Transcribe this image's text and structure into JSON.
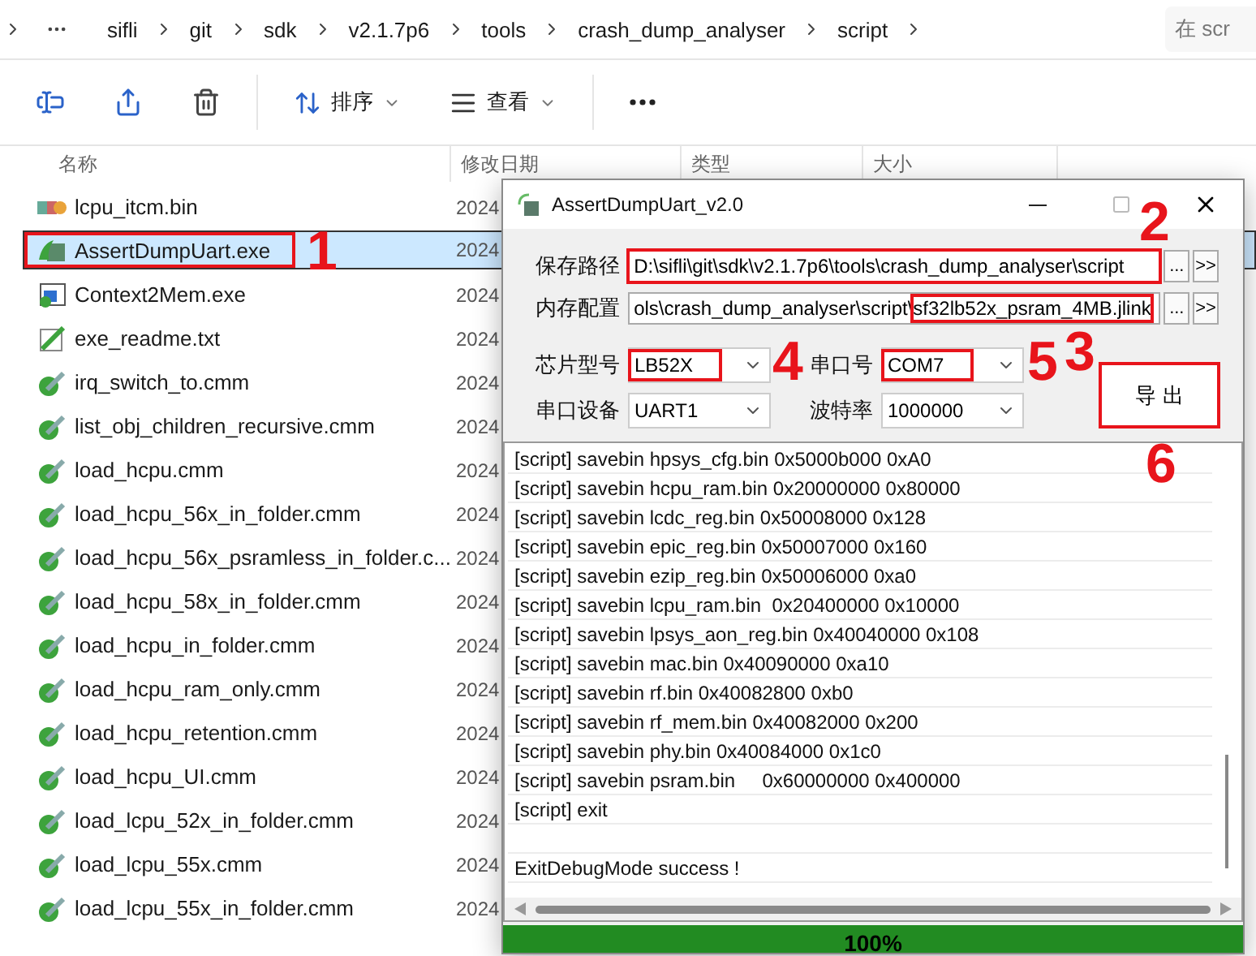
{
  "address_bar": {
    "crumbs": [
      "sifli",
      "git",
      "sdk",
      "v2.1.7p6",
      "tools",
      "crash_dump_analyser",
      "script"
    ],
    "search_placeholder": "在 scr"
  },
  "toolbar": {
    "sort_label": "排序",
    "view_label": "查看"
  },
  "file_list": {
    "columns": [
      "名称",
      "修改日期",
      "类型",
      "大小"
    ],
    "rows": [
      {
        "name": "lcpu_itcm.bin",
        "date": "2024",
        "kind": "bin",
        "selected": false
      },
      {
        "name": "AssertDumpUart.exe",
        "date": "2024",
        "kind": "app",
        "selected": true,
        "marker": "1"
      },
      {
        "name": "Context2Mem.exe",
        "date": "2024",
        "kind": "exe",
        "selected": false
      },
      {
        "name": "exe_readme.txt",
        "date": "2024",
        "kind": "txt",
        "selected": false
      },
      {
        "name": "irq_switch_to.cmm",
        "date": "2024",
        "kind": "cmm",
        "selected": false
      },
      {
        "name": "list_obj_children_recursive.cmm",
        "date": "2024",
        "kind": "cmm",
        "selected": false
      },
      {
        "name": "load_hcpu.cmm",
        "date": "2024",
        "kind": "cmm",
        "selected": false
      },
      {
        "name": "load_hcpu_56x_in_folder.cmm",
        "date": "2024",
        "kind": "cmm",
        "selected": false
      },
      {
        "name": "load_hcpu_56x_psramless_in_folder.c...",
        "date": "2024",
        "kind": "cmm",
        "selected": false
      },
      {
        "name": "load_hcpu_58x_in_folder.cmm",
        "date": "2024",
        "kind": "cmm",
        "selected": false
      },
      {
        "name": "load_hcpu_in_folder.cmm",
        "date": "2024",
        "kind": "cmm",
        "selected": false
      },
      {
        "name": "load_hcpu_ram_only.cmm",
        "date": "2024",
        "kind": "cmm",
        "selected": false
      },
      {
        "name": "load_hcpu_retention.cmm",
        "date": "2024",
        "kind": "cmm",
        "selected": false
      },
      {
        "name": "load_hcpu_UI.cmm",
        "date": "2024",
        "kind": "cmm",
        "selected": false
      },
      {
        "name": "load_lcpu_52x_in_folder.cmm",
        "date": "2024",
        "kind": "cmm",
        "selected": false
      },
      {
        "name": "load_lcpu_55x.cmm",
        "date": "2024",
        "kind": "cmm",
        "selected": false
      },
      {
        "name": "load_lcpu_55x_in_folder.cmm",
        "date": "2024",
        "kind": "cmm",
        "selected": false
      }
    ]
  },
  "dialog": {
    "title": "AssertDumpUart_v2.0",
    "save_path": {
      "label": "保存路径",
      "value": "D:\\sifli\\git\\sdk\\v2.1.7p6\\tools\\crash_dump_analyser\\script",
      "marker": "2",
      "buttons": [
        "...",
        ">>"
      ]
    },
    "memory_config": {
      "label": "内存配置",
      "value_start": "ols\\crash_dump_analyser\\script\\",
      "value_end": "sf32lb52x_psram_4MB.jlink",
      "marker": "3",
      "buttons": [
        "...",
        ">>"
      ]
    },
    "chip": {
      "label": "芯片型号",
      "value": "LB52X",
      "marker": "4"
    },
    "port": {
      "label": "串口号",
      "value": "COM7",
      "marker": "5"
    },
    "device": {
      "label": "串口设备",
      "value": "UART1"
    },
    "baud": {
      "label": "波特率",
      "value": "1000000"
    },
    "export_button": {
      "label": "导 出",
      "marker": "6"
    },
    "log_lines": [
      "[script] savebin hpsys_cfg.bin 0x5000b000 0xA0",
      "[script] savebin hcpu_ram.bin 0x20000000 0x80000",
      "[script] savebin lcdc_reg.bin 0x50008000 0x128",
      "[script] savebin epic_reg.bin 0x50007000 0x160",
      "[script] savebin ezip_reg.bin 0x50006000 0xa0",
      "[script] savebin lcpu_ram.bin  0x20400000 0x10000",
      "[script] savebin lpsys_aon_reg.bin 0x40040000 0x108",
      "[script] savebin mac.bin 0x40090000 0xa10",
      "[script] savebin rf.bin 0x40082800 0xb0",
      "[script] savebin rf_mem.bin 0x40082000 0x200",
      "[script] savebin phy.bin 0x40084000 0x1c0",
      "[script] savebin psram.bin     0x60000000 0x400000",
      "[script] exit"
    ],
    "status_line": "ExitDebugMode success !",
    "progress": {
      "level": 1,
      "label": "100%"
    }
  }
}
